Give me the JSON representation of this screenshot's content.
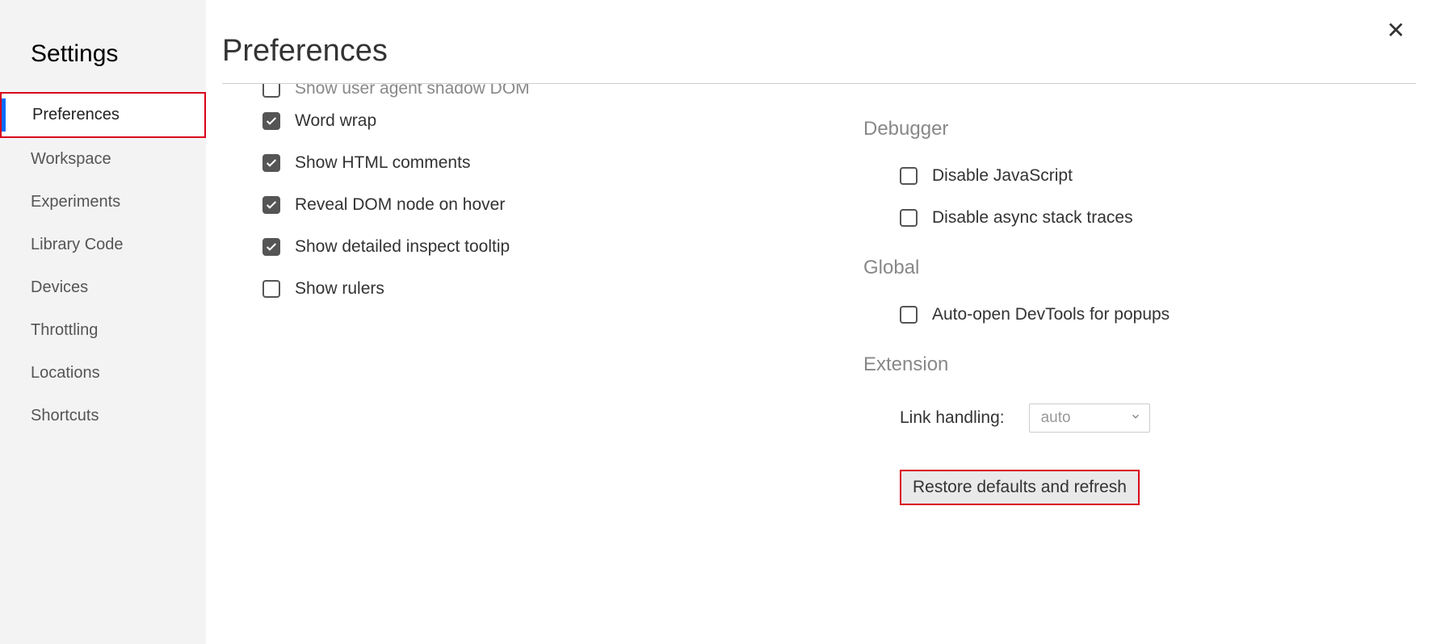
{
  "sidebar": {
    "title": "Settings",
    "items": [
      {
        "label": "Preferences",
        "selected": true
      },
      {
        "label": "Workspace",
        "selected": false
      },
      {
        "label": "Experiments",
        "selected": false
      },
      {
        "label": "Library Code",
        "selected": false
      },
      {
        "label": "Devices",
        "selected": false
      },
      {
        "label": "Throttling",
        "selected": false
      },
      {
        "label": "Locations",
        "selected": false
      },
      {
        "label": "Shortcuts",
        "selected": false
      }
    ]
  },
  "page": {
    "title": "Preferences"
  },
  "left_column": {
    "settings": [
      {
        "label": "Show user agent shadow DOM",
        "checked": false,
        "cutoff": true
      },
      {
        "label": "Word wrap",
        "checked": true
      },
      {
        "label": "Show HTML comments",
        "checked": true
      },
      {
        "label": "Reveal DOM node on hover",
        "checked": true
      },
      {
        "label": "Show detailed inspect tooltip",
        "checked": true
      },
      {
        "label": "Show rulers",
        "checked": false
      }
    ]
  },
  "right_column": {
    "sections": [
      {
        "title": "Debugger",
        "settings": [
          {
            "label": "Disable JavaScript",
            "checked": false
          },
          {
            "label": "Disable async stack traces",
            "checked": false
          }
        ]
      },
      {
        "title": "Global",
        "settings": [
          {
            "label": "Auto-open DevTools for popups",
            "checked": false
          }
        ]
      },
      {
        "title": "Extension",
        "fields": [
          {
            "label": "Link handling:",
            "value": "auto"
          }
        ]
      }
    ],
    "restore_button": "Restore defaults and refresh"
  }
}
